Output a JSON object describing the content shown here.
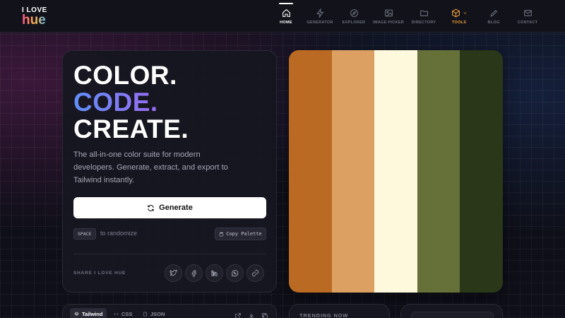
{
  "brand": {
    "line1": "I LOVE",
    "line2": "hue"
  },
  "nav": [
    {
      "label": "HOME",
      "icon": "home-icon",
      "active": true
    },
    {
      "label": "GENERATOR",
      "icon": "bolt-icon"
    },
    {
      "label": "EXPLORER",
      "icon": "compass-icon"
    },
    {
      "label": "IMAGE PICKER",
      "icon": "image-icon"
    },
    {
      "label": "DIRECTORY",
      "icon": "folder-icon"
    },
    {
      "label": "TOOLS",
      "icon": "cube-icon",
      "dropdown": true,
      "accent": "#f0a236"
    },
    {
      "label": "BLOG",
      "icon": "pen-icon"
    },
    {
      "label": "CONTACT",
      "icon": "mail-icon"
    }
  ],
  "hero": {
    "line1": "COLOR.",
    "line2": "CODE.",
    "line3": "CREATE.",
    "subtitle": "The all-in-one color suite for modern developers. Generate, extract, and export to Tailwind instantly.",
    "generate_label": "Generate",
    "space_key": "SPACE",
    "randomize_text": "to randomize",
    "copy_label": "Copy Palette",
    "share_label": "SHARE I LOVE HUE",
    "share_icons": [
      "twitter-icon",
      "facebook-icon",
      "linkedin-icon",
      "whatsapp-icon",
      "link-icon"
    ]
  },
  "palette": [
    "#bb6a24",
    "#dca162",
    "#fef8dc",
    "#667039",
    "#2a3719"
  ],
  "code_tabs": [
    {
      "label": "Tailwind",
      "active": true
    },
    {
      "label": "CSS"
    },
    {
      "label": "JSON"
    }
  ],
  "trending": {
    "title": "TRENDING NOW"
  }
}
